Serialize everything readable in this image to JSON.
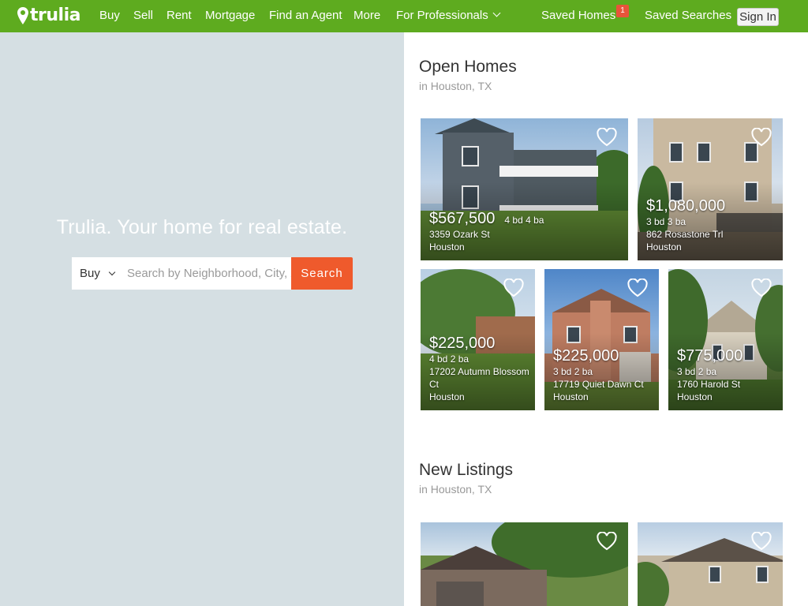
{
  "nav": {
    "logo": "trulia",
    "items": [
      "Buy",
      "Sell",
      "Rent",
      "Mortgage",
      "Find an Agent",
      "More",
      "For Professionals"
    ],
    "saved_homes": "Saved Homes",
    "saved_homes_count": "1",
    "saved_searches": "Saved Searches",
    "sign_in": "Sign In"
  },
  "hero": {
    "tagline": "Trulia. Your home for real estate.",
    "search_type": "Buy",
    "search_placeholder": "Search by Neighborhood, City, ZIP or Address",
    "search_button": "Search"
  },
  "open_homes": {
    "title": "Open Homes",
    "subtitle": "in Houston, TX",
    "listings": [
      {
        "price": "$567,500",
        "beds_baths": "4 bd 4 ba",
        "address": "3359 Ozark St",
        "city": "Houston"
      },
      {
        "price": "$1,080,000",
        "beds_baths": "3 bd 3 ba",
        "address": "862 Rosastone Trl",
        "city": "Houston"
      },
      {
        "price": "$225,000",
        "beds_baths": "4 bd 2 ba",
        "address": "17202 Autumn Blossom Ct",
        "city": "Houston"
      },
      {
        "price": "$225,000",
        "beds_baths": "3 bd 2 ba",
        "address": "17719 Quiet Dawn Ct",
        "city": "Houston"
      },
      {
        "price": "$775,000",
        "beds_baths": "3 bd 2 ba",
        "address": "1760 Harold St",
        "city": "Houston"
      }
    ]
  },
  "new_listings": {
    "title": "New Listings",
    "subtitle": "in Houston, TX"
  },
  "colors": {
    "brand_green": "#5eab1f",
    "search_orange": "#ef5a2c",
    "badge_red": "#e8543a"
  }
}
